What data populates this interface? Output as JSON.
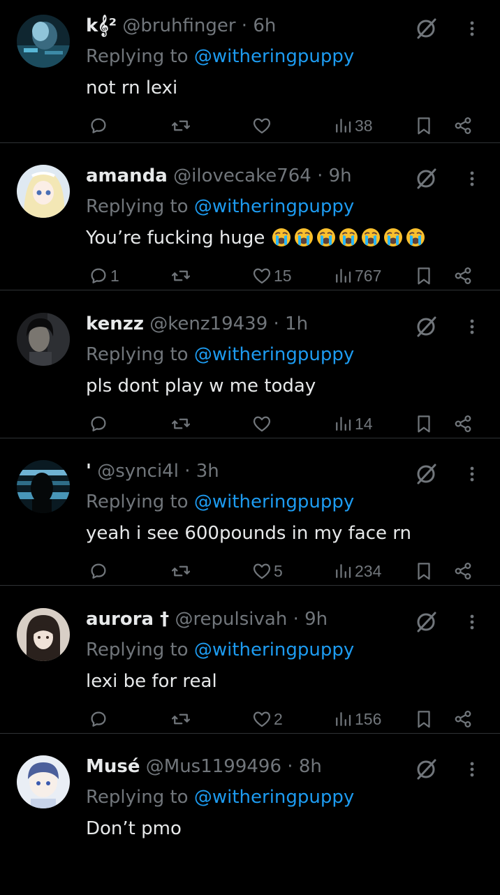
{
  "replying_label": "Replying to",
  "tweets": [
    {
      "name": "k𝄞²",
      "handle": "@bruhfinger",
      "dot": "·",
      "time": "6h",
      "mention": "@witheringpuppy",
      "text": "not rn lexi",
      "replies": "",
      "retweets": "",
      "likes": "",
      "views": "38",
      "emojis": 0
    },
    {
      "name": "amanda",
      "handle": "@ilovecake764",
      "dot": "·",
      "time": "9h",
      "mention": "@witheringpuppy",
      "text": "You’re fucking huge",
      "replies": "1",
      "retweets": "",
      "likes": "15",
      "views": "767",
      "emojis": 7,
      "emoji_name": "loudly-crying-face"
    },
    {
      "name": "kenzz",
      "handle": "@kenz19439",
      "dot": "·",
      "time": "1h",
      "mention": "@witheringpuppy",
      "text": "pls dont play w me today",
      "replies": "",
      "retweets": "",
      "likes": "",
      "views": "14",
      "emojis": 0
    },
    {
      "name": "'",
      "handle": "@synci4l",
      "dot": "·",
      "time": "3h",
      "mention": "@witheringpuppy",
      "text": "yeah i see 600pounds in my face rn",
      "replies": "",
      "retweets": "",
      "likes": "5",
      "views": "234",
      "emojis": 0
    },
    {
      "name": "aurora †",
      "handle": "@repulsivah",
      "dot": "·",
      "time": "9h",
      "mention": "@witheringpuppy",
      "text": "lexi be for real",
      "replies": "",
      "retweets": "",
      "likes": "2",
      "views": "156",
      "emojis": 0
    },
    {
      "name": "Musé",
      "handle": "@Mus1199496",
      "dot": "·",
      "time": "8h",
      "mention": "@witheringpuppy",
      "text": "Don’t pmo",
      "replies": "",
      "retweets": "",
      "likes": "",
      "views": "",
      "emojis": 0
    }
  ],
  "colors": {
    "background": "#000000",
    "text": "#e7e9ea",
    "muted": "#71767b",
    "link": "#1d9bf0",
    "divider": "#2f3336"
  },
  "icons": {
    "reply": "reply-icon",
    "retweet": "retweet-icon",
    "like": "heart-icon",
    "views": "views-icon",
    "bookmark": "bookmark-icon",
    "share": "share-icon",
    "grok": "grok-icon",
    "more": "more-icon"
  }
}
